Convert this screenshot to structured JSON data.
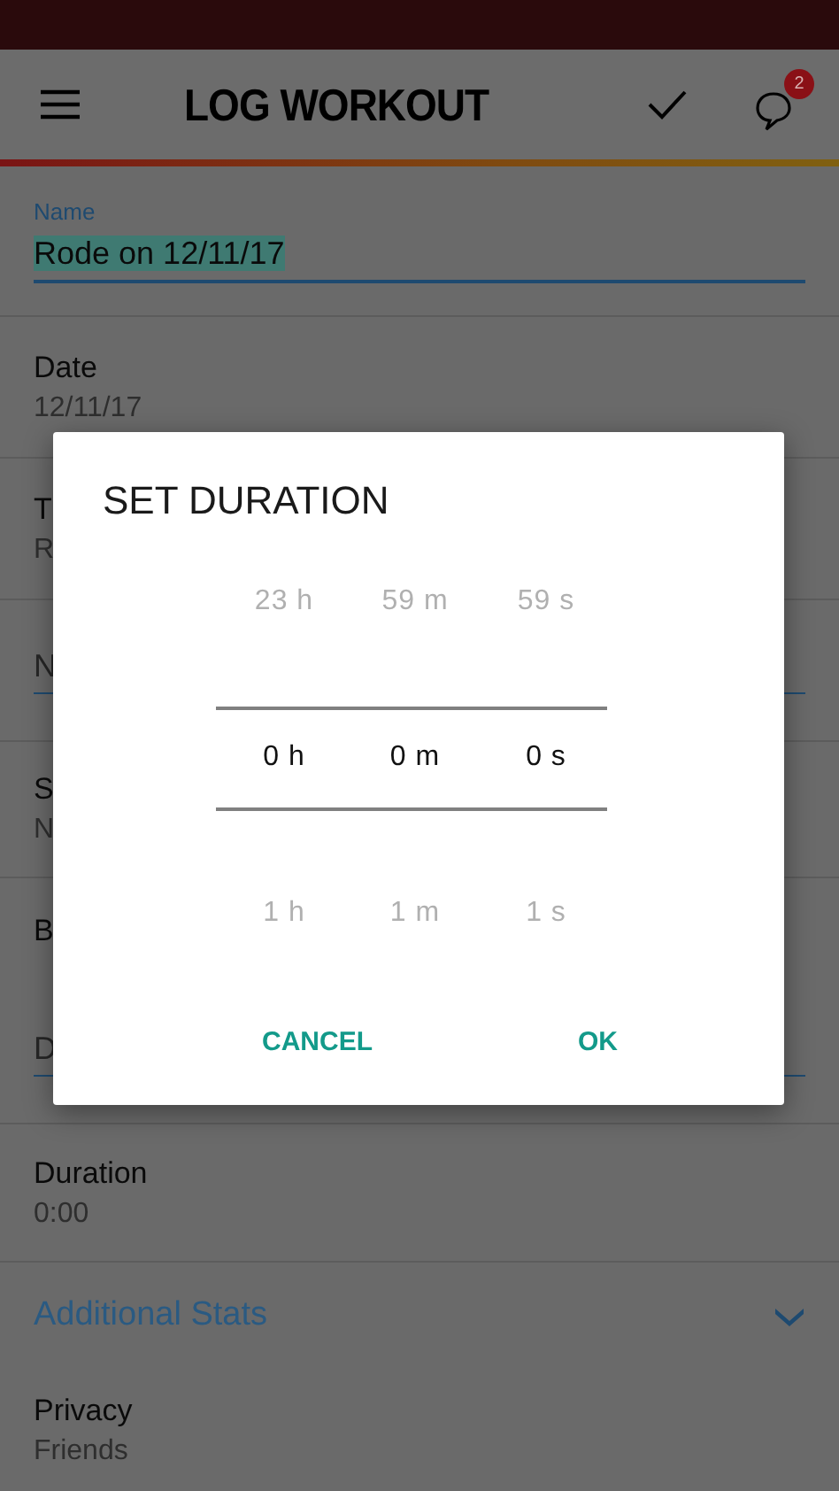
{
  "header": {
    "title": "LOG WORKOUT",
    "notification_count": "2"
  },
  "form": [
    {
      "kind": "text_input",
      "label": "Name",
      "value": "Rode on 12/11/17",
      "highlighted": true
    },
    {
      "kind": "detail",
      "label": "Date",
      "value": "12/11/17"
    },
    {
      "kind": "detail",
      "label": "T",
      "value": "R"
    },
    {
      "kind": "input",
      "placeholder": "N"
    },
    {
      "kind": "detail",
      "label": "S",
      "value": "N"
    },
    {
      "kind": "label",
      "label": "B"
    },
    {
      "kind": "input",
      "placeholder": "D"
    },
    {
      "kind": "detail",
      "label": "Duration",
      "value": "0:00"
    },
    {
      "kind": "expander",
      "label": "Additional Stats"
    },
    {
      "kind": "detail",
      "label": "Privacy",
      "value": "Friends"
    }
  ],
  "dialog": {
    "title": "SET DURATION",
    "picker": [
      {
        "above": "23 h",
        "value": "0 h",
        "below": "1 h"
      },
      {
        "above": "59 m",
        "value": "0 m",
        "below": "1 m"
      },
      {
        "above": "59 s",
        "value": "0 s",
        "below": "1 s"
      }
    ],
    "buttons": [
      "CANCEL",
      "OK"
    ]
  }
}
